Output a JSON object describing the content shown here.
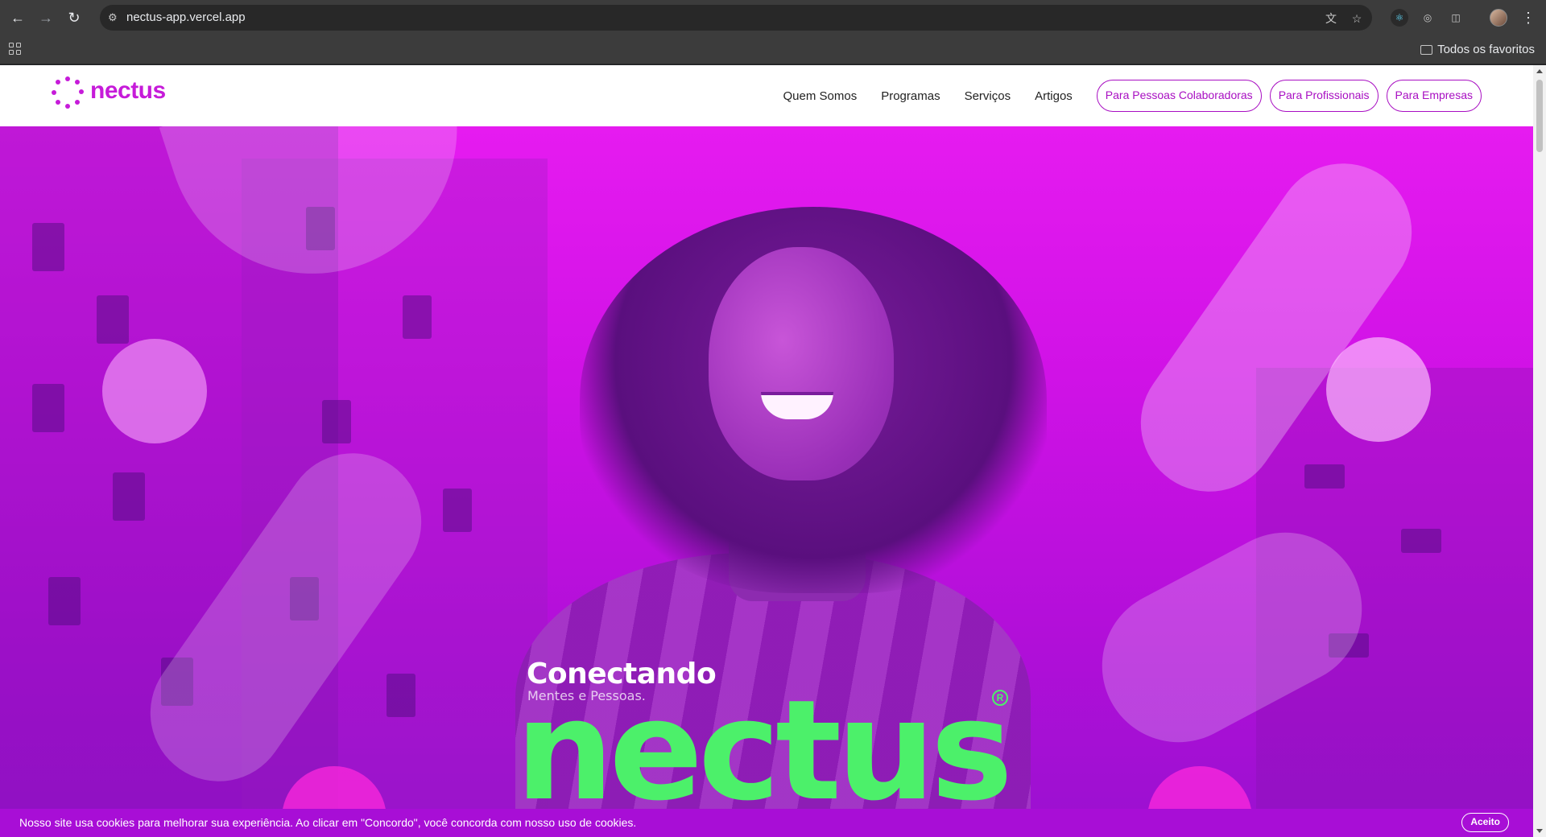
{
  "browser": {
    "url": "nectus-app.vercel.app",
    "bookmarks_all": "Todos os favoritos",
    "icons": [
      "back-icon",
      "forward-icon",
      "reload-icon",
      "site-info-icon",
      "translate-icon",
      "star-icon",
      "react-devtools-icon",
      "target-extension-icon",
      "extensions-icon",
      "profile-avatar",
      "menu-dots-icon",
      "apps-grid-icon",
      "folder-icon"
    ]
  },
  "header": {
    "brand": "nectus",
    "nav": [
      "Quem Somos",
      "Programas",
      "Serviços",
      "Artigos"
    ],
    "pills": [
      "Para Pessoas Colaboradoras",
      "Para Profissionais",
      "Para Empresas"
    ]
  },
  "hero": {
    "title": "Conectando",
    "subtitle": "Mentes e Pessoas.",
    "logo": "nectus",
    "registered": "R"
  },
  "cookie": {
    "text": "Nosso site usa cookies para melhorar sua experiência. Ao clicar em \"Concordo\", você concorda com nosso uso de cookies.",
    "button": "Aceito"
  },
  "colors": {
    "brand_magenta": "#c61bd9",
    "hero_magenta": "#e61bf0",
    "logo_green": "#4cf06a",
    "cookie_bar": "#a80ed6"
  }
}
